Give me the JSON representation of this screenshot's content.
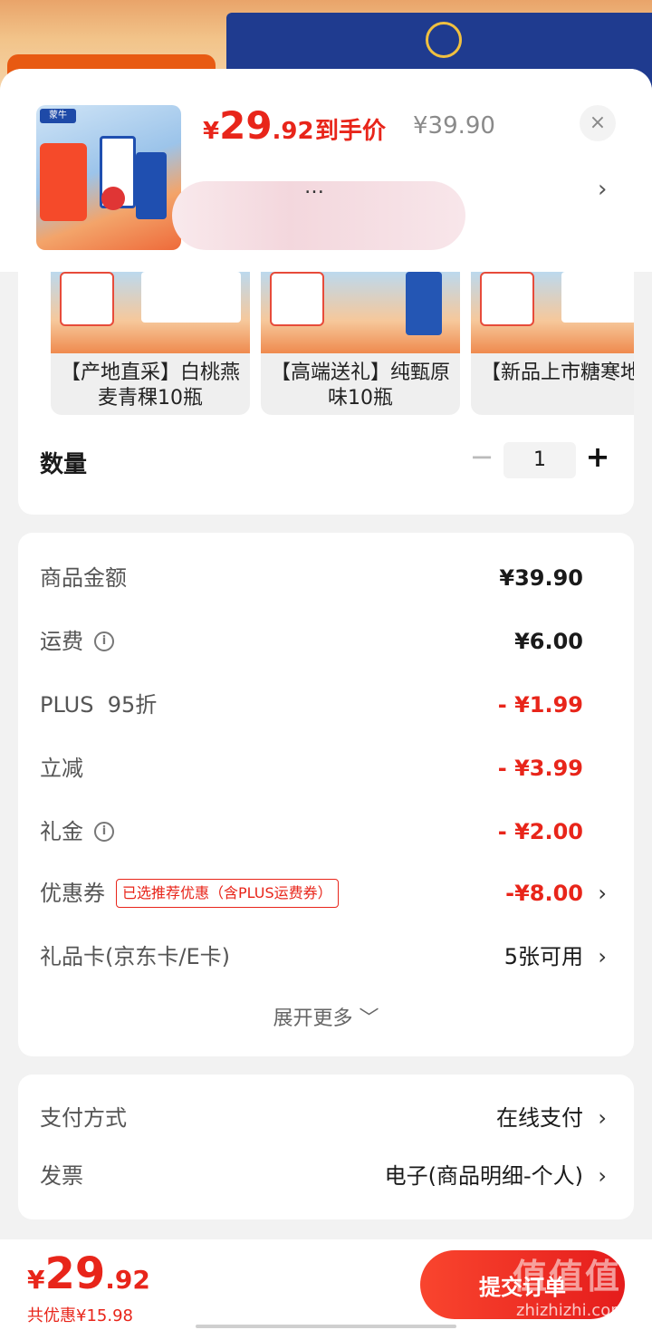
{
  "header": {
    "price_currency": "¥",
    "price_int": "29",
    "price_dec": ".92",
    "price_label": "到手价",
    "original_price": "¥39.90",
    "close_glyph": "×",
    "variant_text": "…",
    "variant_arrow": "›"
  },
  "variants": [
    {
      "name": "【产地直采】白桃燕麦青稞10瓶"
    },
    {
      "name": "【高端送礼】纯甄原味10瓶"
    },
    {
      "name": "【新品上市糖寒地蓝"
    }
  ],
  "quantity": {
    "label": "数量",
    "minus": "−",
    "value": "1",
    "plus": "+"
  },
  "breakdown": {
    "rows": [
      {
        "label": "商品金额",
        "value": "¥39.90"
      },
      {
        "label": "运费",
        "value": "¥6.00"
      },
      {
        "label": "PLUS  95折",
        "value": "- ¥1.99"
      },
      {
        "label": "立减",
        "value": "- ¥3.99"
      },
      {
        "label": "礼金",
        "value": "- ¥2.00"
      },
      {
        "label": "优惠券",
        "tag": "已选推荐优惠（含PLUS运费券）",
        "value": "-¥8.00"
      },
      {
        "label": "礼品卡(京东卡/E卡)",
        "value": "5张可用"
      }
    ],
    "expand_label": "展开更多 ﹀"
  },
  "payment": {
    "method_label": "支付方式",
    "method_value": "在线支付",
    "invoice_label": "发票",
    "invoice_value": "电子(商品明细-个人)"
  },
  "bottom": {
    "currency": "¥",
    "total_int": "29",
    "total_dec": ".92",
    "saved_text": "共优惠¥15.98",
    "submit_label": "提交订单"
  },
  "watermark": {
    "brand": "值值值",
    "site": "zhizhizhi.com"
  },
  "colors": {
    "accent": "#e8251a",
    "background": "#f2f2f2"
  }
}
